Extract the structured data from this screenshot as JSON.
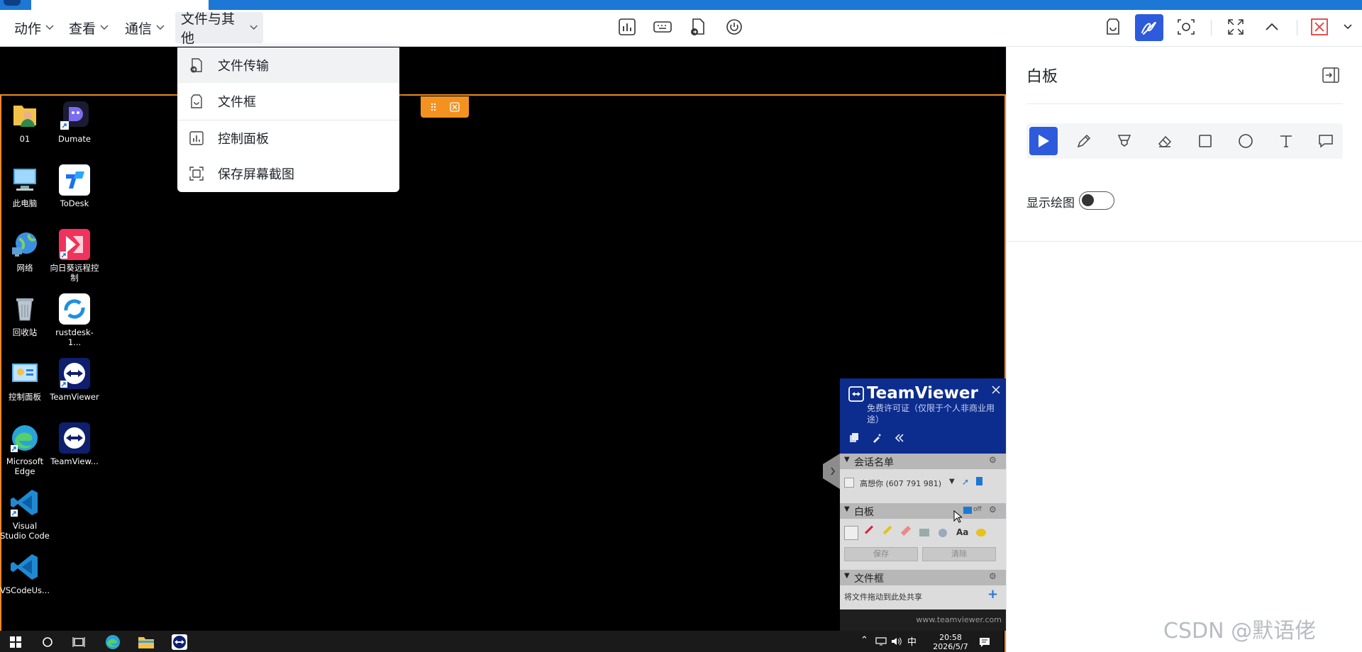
{
  "menubar": {
    "menus": [
      {
        "label": "动作"
      },
      {
        "label": "查看"
      },
      {
        "label": "通信"
      },
      {
        "label": "文件与其他"
      }
    ]
  },
  "dropdown": {
    "items": [
      {
        "label": "文件传输",
        "icon": "file-transfer-icon"
      },
      {
        "label": "文件框",
        "icon": "file-box-icon"
      },
      {
        "label": "控制面板",
        "icon": "control-panel-icon"
      },
      {
        "label": "保存屏幕截图",
        "icon": "screenshot-icon"
      }
    ]
  },
  "desktop": {
    "icons": [
      {
        "label": "01"
      },
      {
        "label": "Dumate"
      },
      {
        "label": "此电脑"
      },
      {
        "label": "ToDesk"
      },
      {
        "label": "网络"
      },
      {
        "label": "向日葵远程控制"
      },
      {
        "label": "回收站"
      },
      {
        "label": "rustdesk-1..."
      },
      {
        "label": "控制面板"
      },
      {
        "label": "TeamViewer"
      },
      {
        "label": "Microsoft Edge"
      },
      {
        "label": "TeamView..."
      },
      {
        "label": "Visual Studio Code"
      },
      {
        "label": "VSCodeUs..."
      }
    ]
  },
  "teamviewer": {
    "brand": "TeamViewer",
    "license": "免费许可证（仅限于个人非商业用途）",
    "session_title": "会话名单",
    "session_entry": "高想你 (607 791 981)",
    "whiteboard_title": "白板",
    "toggle_state": "off",
    "save_label": "保存",
    "clear_label": "清除",
    "filebox_title": "文件框",
    "filebox_hint": "将文件拖动到此处共享",
    "url": "www.teamviewer.com"
  },
  "taskbar": {
    "ime": "中",
    "time": "20:58",
    "date": "2026/5/7"
  },
  "panel": {
    "title": "白板",
    "show_drawing_label": "显示绘图",
    "tools": [
      "pointer",
      "pencil",
      "highlighter",
      "eraser",
      "rectangle",
      "ellipse",
      "text",
      "comment"
    ]
  },
  "watermark": "CSDN @默语佬",
  "colors": {
    "accent": "#2d5bdc",
    "frame_orange": "#ee8a22",
    "top_blue": "#1c78d4",
    "teamviewer_blue": "#0c2d8e"
  }
}
